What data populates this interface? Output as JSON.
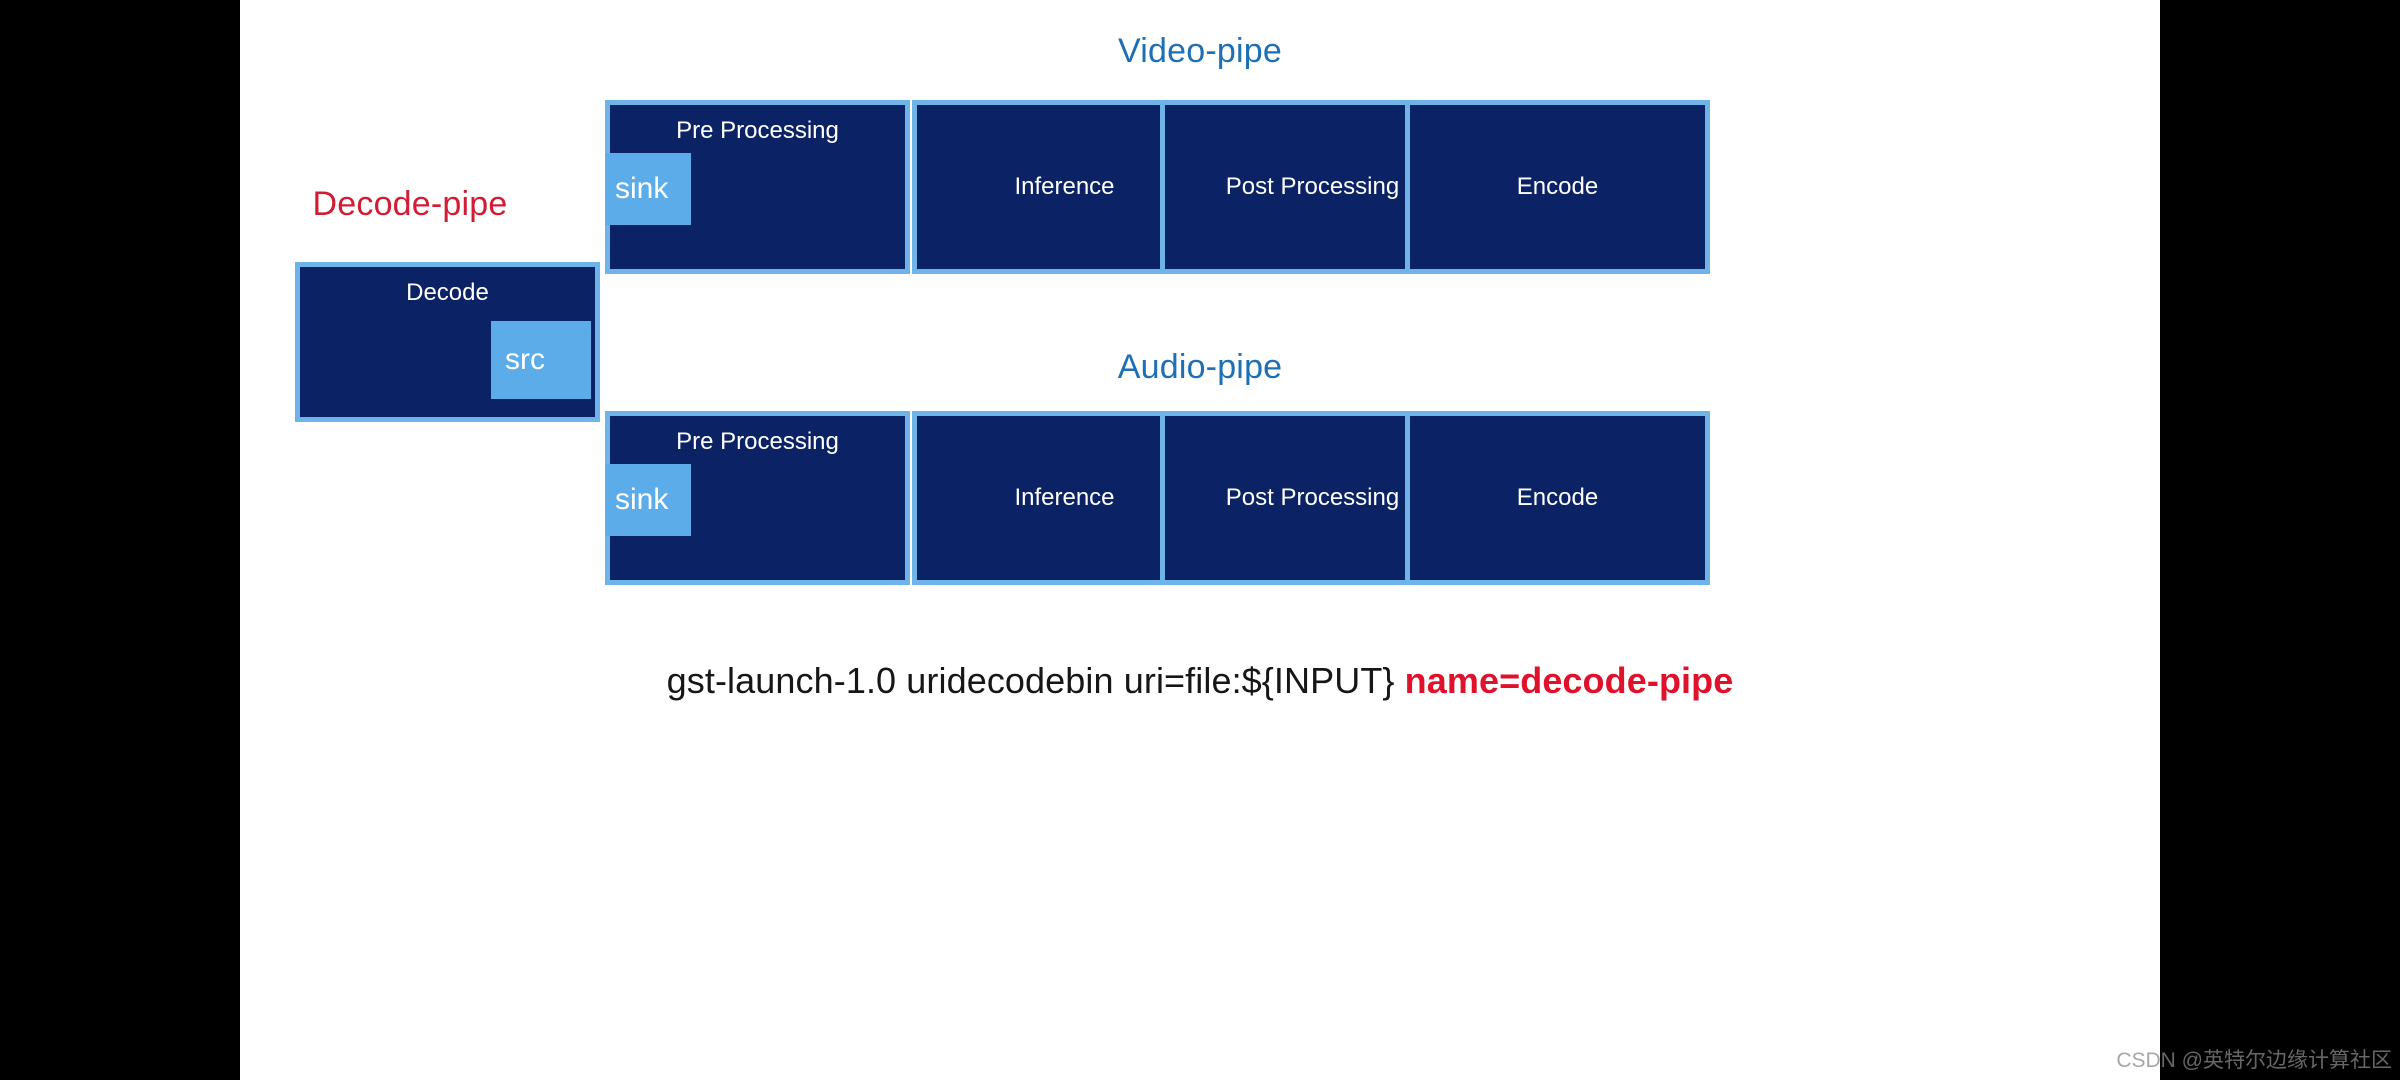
{
  "slide": {
    "background_color": "#ffffff",
    "letterbox_color": "#000000"
  },
  "colors": {
    "pipe_title": "#1F6FB5",
    "decode_title": "#D21C34",
    "box_fill": "#0B2265",
    "box_border": "#6EB4E8",
    "pad_fill": "#5BACE8",
    "command_text": "#161616",
    "command_highlight": "#E0112B"
  },
  "decode_pipe": {
    "title": "Decode-pipe",
    "box": {
      "label": "Decode",
      "pad": {
        "name": "src",
        "label": "src"
      }
    }
  },
  "video_pipe": {
    "title": "Video-pipe",
    "boxes": [
      {
        "label": "Pre Processing",
        "label_pos": "top",
        "pad": {
          "name": "sink",
          "label": "sink"
        }
      },
      {
        "label": "Inference",
        "label_pos": "middle",
        "pad": null
      },
      {
        "label": "Post Processing",
        "label_pos": "middle",
        "pad": null
      },
      {
        "label": "Encode",
        "label_pos": "middle",
        "pad": null
      }
    ]
  },
  "audio_pipe": {
    "title": "Audio-pipe",
    "boxes": [
      {
        "label": "Pre Processing",
        "label_pos": "top",
        "pad": {
          "name": "sink",
          "label": "sink"
        }
      },
      {
        "label": "Inference",
        "label_pos": "middle",
        "pad": null
      },
      {
        "label": "Post Processing",
        "label_pos": "middle",
        "pad": null
      },
      {
        "label": "Encode",
        "label_pos": "middle",
        "pad": null
      }
    ]
  },
  "command": {
    "plain": "gst-launch-1.0 uridecodebin  uri=file:${INPUT} ",
    "highlight": "name=decode-pipe"
  },
  "watermark": {
    "text": "CSDN @英特尔边缘计算社区"
  }
}
